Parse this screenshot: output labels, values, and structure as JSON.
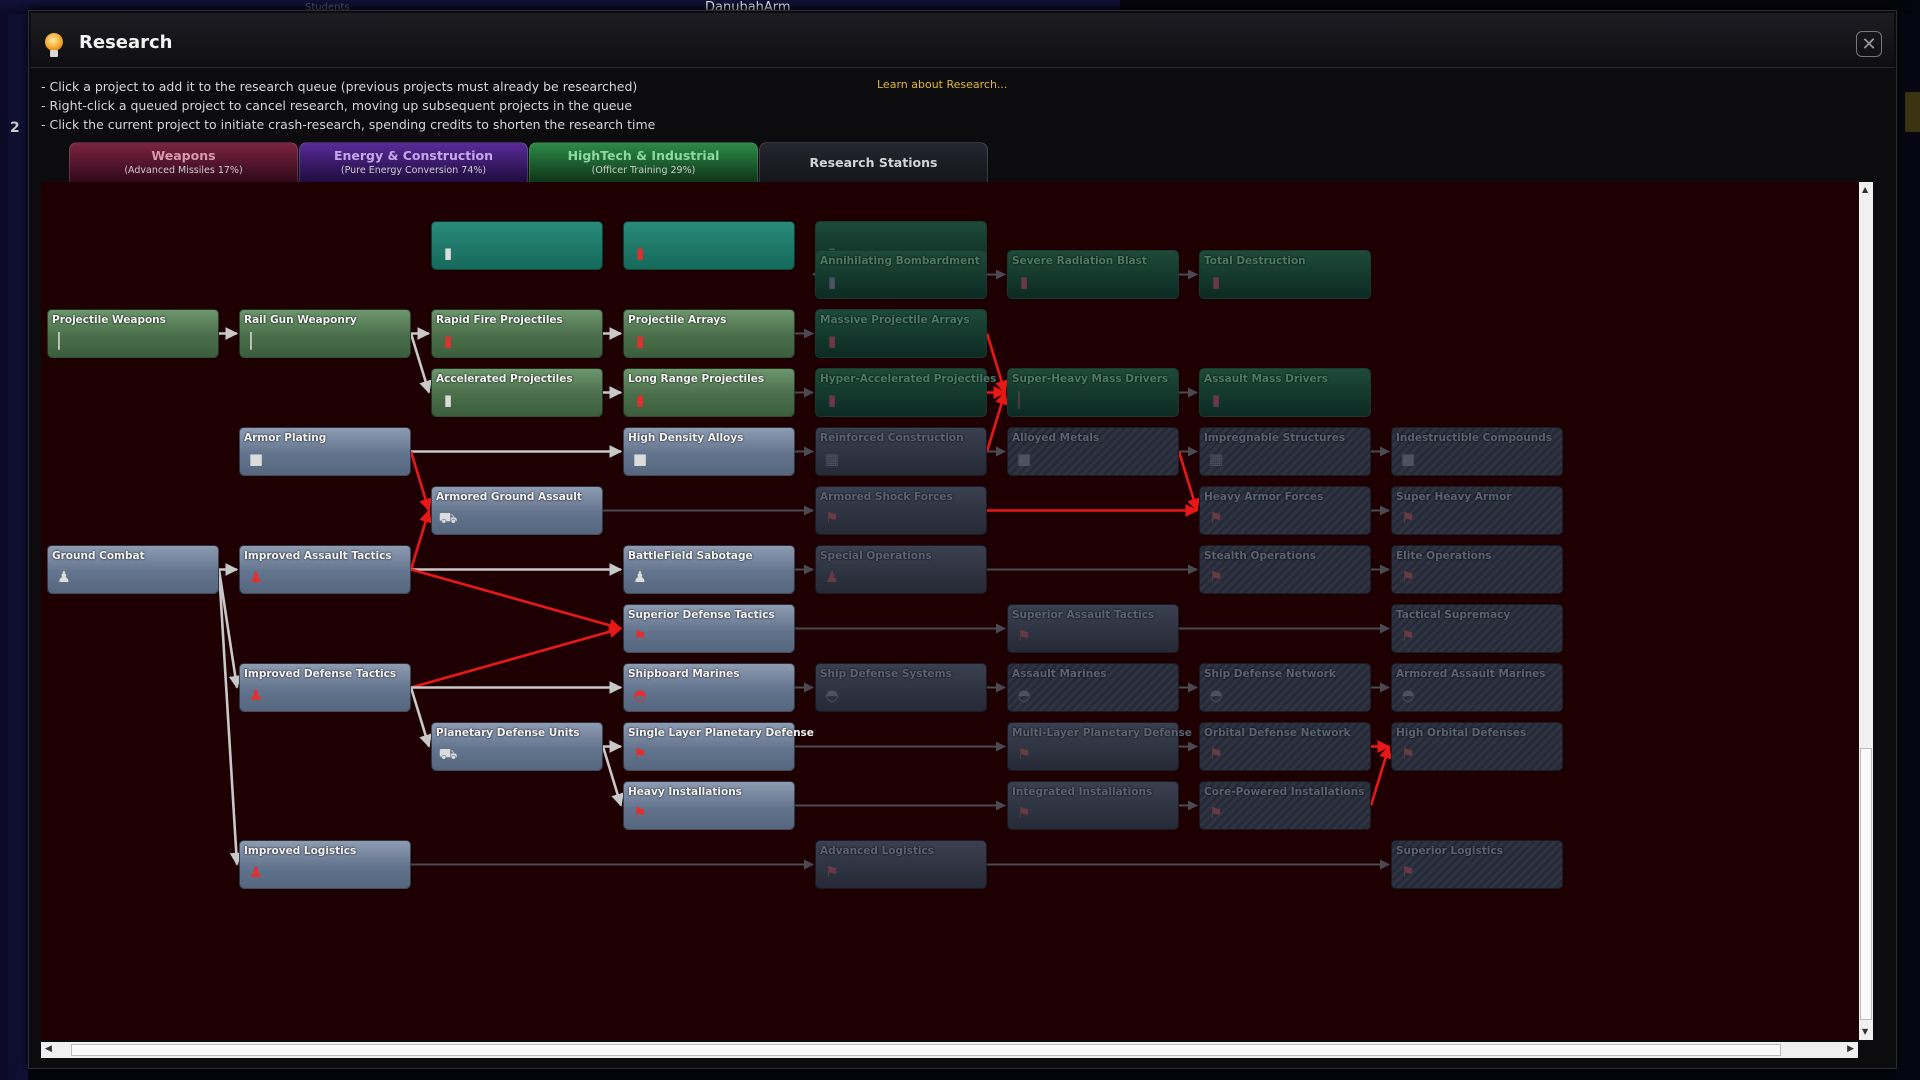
{
  "background": {
    "top_label": "DanubahArm",
    "top_label2": "Students",
    "left_number": "2"
  },
  "window": {
    "title": "Research",
    "title_icon": "light-bulb-icon",
    "close_glyph": "✕"
  },
  "instructions": [
    "- Click a project to add it to the research queue (previous projects must already be researched)",
    "- Right-click a queued project to cancel research, moving up subsequent projects in the queue",
    "- Click the current project to initiate crash-research, spending credits to shorten the research time"
  ],
  "learn_link": "Learn about Research...",
  "tabs": [
    {
      "id": "weapons",
      "label": "Weapons",
      "sub": "(Advanced Missiles 17%)",
      "color": "#7a2440"
    },
    {
      "id": "energy",
      "label": "Energy & Construction",
      "sub": "(Pure Energy Conversion 74%)",
      "color": "#5a2a98"
    },
    {
      "id": "hightech",
      "label": "HighTech & Industrial",
      "sub": "(Officer Training 29%)",
      "color": "#2c8a48"
    },
    {
      "id": "stations",
      "label": "Research Stations",
      "sub": "",
      "color": "#262630"
    }
  ],
  "scrollbars": {
    "left": "◀",
    "right": "▶",
    "up": "▲",
    "down": "▼"
  },
  "nodes": [
    {
      "id": "teal1",
      "label": "",
      "style": "teal",
      "icon": "shell-icon",
      "glyph": "▮",
      "tone": "silver",
      "col": 2,
      "row": -0.5
    },
    {
      "id": "teal2",
      "label": "",
      "style": "teal",
      "icon": "shell-icon",
      "glyph": "▮",
      "tone": "red",
      "col": 3,
      "row": -0.5
    },
    {
      "id": "teal3",
      "label": "",
      "style": "dgreen",
      "icon": "shell-icon",
      "glyph": "▮",
      "tone": "dimgray",
      "col": 4,
      "row": -0.5
    },
    {
      "id": "annihilating",
      "label": "Annihilating Bombardment",
      "style": "dgreen",
      "icon": "bomb-icon",
      "glyph": "▮",
      "tone": "dimgray",
      "col": 4,
      "row": 0
    },
    {
      "id": "severe",
      "label": "Severe Radiation Blast",
      "style": "dgreen",
      "icon": "radiation-icon",
      "glyph": "▮",
      "tone": "dim",
      "col": 5,
      "row": 0
    },
    {
      "id": "total",
      "label": "Total Destruction",
      "style": "dgreen",
      "icon": "bomb-icon",
      "glyph": "▮",
      "tone": "dim",
      "col": 6,
      "row": 0
    },
    {
      "id": "projweap",
      "label": "Projectile Weapons",
      "style": "green",
      "icon": "projectile-icon",
      "glyph": "▏",
      "tone": "silver",
      "col": 0,
      "row": 1
    },
    {
      "id": "railgun",
      "label": "Rail Gun Weaponry",
      "style": "green",
      "icon": "projectile-icon",
      "glyph": "▏",
      "tone": "silver",
      "col": 1,
      "row": 1
    },
    {
      "id": "rapidfire",
      "label": "Rapid Fire Projectiles",
      "style": "green",
      "icon": "shell-icon",
      "glyph": "▮",
      "tone": "red",
      "col": 2,
      "row": 1
    },
    {
      "id": "projarrays",
      "label": "Projectile Arrays",
      "style": "green",
      "icon": "shell-icon",
      "glyph": "▮",
      "tone": "red",
      "col": 3,
      "row": 1
    },
    {
      "id": "massive",
      "label": "Massive Projectile Arrays",
      "style": "dgreen",
      "icon": "shell-icon",
      "glyph": "▮",
      "tone": "dim",
      "col": 4,
      "row": 1
    },
    {
      "id": "accel",
      "label": "Accelerated Projectiles",
      "style": "green",
      "icon": "projectile-icon",
      "glyph": "▮",
      "tone": "silver",
      "col": 2,
      "row": 2
    },
    {
      "id": "longrange",
      "label": "Long Range Projectiles",
      "style": "green",
      "icon": "shell-icon",
      "glyph": "▮",
      "tone": "red",
      "col": 3,
      "row": 2
    },
    {
      "id": "hyperaccel",
      "label": "Hyper-Accelerated Projectiles",
      "style": "dgreen",
      "icon": "shell-icon",
      "glyph": "▮",
      "tone": "dim",
      "col": 4,
      "row": 2
    },
    {
      "id": "superheavy",
      "label": "Super-Heavy Mass Drivers",
      "style": "dgreen",
      "icon": "projectile-icon",
      "glyph": "▏",
      "tone": "dim",
      "col": 5,
      "row": 2
    },
    {
      "id": "assaultmass",
      "label": "Assault Mass Drivers",
      "style": "dgreen",
      "icon": "shell-icon",
      "glyph": "▮",
      "tone": "dim",
      "col": 6,
      "row": 2
    },
    {
      "id": "armor",
      "label": "Armor Plating",
      "style": "blue",
      "icon": "armor-plate-icon",
      "glyph": "■",
      "tone": "silver",
      "col": 1,
      "row": 3
    },
    {
      "id": "highdensity",
      "label": "High Density Alloys",
      "style": "blue",
      "icon": "armor-plate-icon",
      "glyph": "■",
      "tone": "silver",
      "col": 3,
      "row": 3
    },
    {
      "id": "reinforced",
      "label": "Reinforced Construction",
      "style": "dgray",
      "icon": "structure-icon",
      "glyph": "▦",
      "tone": "dimgray",
      "col": 4,
      "row": 3
    },
    {
      "id": "alloyed",
      "label": "Alloyed Metals",
      "style": "dgray hatched",
      "icon": "armor-plate-icon",
      "glyph": "■",
      "tone": "dimgray",
      "col": 5,
      "row": 3
    },
    {
      "id": "impregnable",
      "label": "Impregnable Structures",
      "style": "dgray hatched",
      "icon": "structure-icon",
      "glyph": "▦",
      "tone": "dimgray",
      "col": 6,
      "row": 3
    },
    {
      "id": "indestructible",
      "label": "Indestructible Compounds",
      "style": "dgray hatched",
      "icon": "armor-plate-icon",
      "glyph": "■",
      "tone": "dimgray",
      "col": 7,
      "row": 3
    },
    {
      "id": "armoredground",
      "label": "Armored Ground Assault",
      "style": "blue",
      "icon": "tank-icon",
      "glyph": "⛟",
      "tone": "silver",
      "col": 2,
      "row": 4
    },
    {
      "id": "armoredshock",
      "label": "Armored Shock Forces",
      "style": "dgray",
      "icon": "flag-icon",
      "glyph": "⚑",
      "tone": "dim",
      "col": 4,
      "row": 4
    },
    {
      "id": "heavyarmor",
      "label": "Heavy Armor Forces",
      "style": "dgray hatched",
      "icon": "flag-icon",
      "glyph": "⚑",
      "tone": "dim",
      "col": 6,
      "row": 4
    },
    {
      "id": "superheavyarmor",
      "label": "Super Heavy Armor",
      "style": "dgray hatched",
      "icon": "flag-icon",
      "glyph": "⚑",
      "tone": "dim",
      "col": 7,
      "row": 4
    },
    {
      "id": "groundcombat",
      "label": "Ground Combat",
      "style": "blue",
      "icon": "soldiers-icon",
      "glyph": "♟",
      "tone": "silver",
      "col": 0,
      "row": 5
    },
    {
      "id": "assaulttactics",
      "label": "Improved Assault Tactics",
      "style": "blue",
      "icon": "soldiers-icon",
      "glyph": "♟",
      "tone": "red",
      "col": 1,
      "row": 5
    },
    {
      "id": "sabotage",
      "label": "BattleField Sabotage",
      "style": "blue",
      "icon": "soldiers-icon",
      "glyph": "♟",
      "tone": "silver",
      "col": 3,
      "row": 5
    },
    {
      "id": "specialops",
      "label": "Special Operations",
      "style": "dgray",
      "icon": "soldiers-icon",
      "glyph": "♟",
      "tone": "dim",
      "col": 4,
      "row": 5
    },
    {
      "id": "stealthops",
      "label": "Stealth Operations",
      "style": "dgray hatched",
      "icon": "flag-icon",
      "glyph": "⚑",
      "tone": "dim",
      "col": 6,
      "row": 5
    },
    {
      "id": "eliteops",
      "label": "Elite Operations",
      "style": "dgray hatched",
      "icon": "flag-icon",
      "glyph": "⚑",
      "tone": "dim",
      "col": 7,
      "row": 5
    },
    {
      "id": "superiordef",
      "label": "Superior Defense Tactics",
      "style": "blue",
      "icon": "flag-icon",
      "glyph": "⚑",
      "tone": "red",
      "col": 3,
      "row": 6
    },
    {
      "id": "superiorassault",
      "label": "Superior Assault Tactics",
      "style": "dgray",
      "icon": "flag-icon",
      "glyph": "⚑",
      "tone": "dim",
      "col": 5,
      "row": 6
    },
    {
      "id": "tactical",
      "label": "Tactical Supremacy",
      "style": "dgray hatched",
      "icon": "flag-icon",
      "glyph": "⚑",
      "tone": "dim",
      "col": 7,
      "row": 6
    },
    {
      "id": "deftactics",
      "label": "Improved Defense Tactics",
      "style": "blue",
      "icon": "soldiers-icon",
      "glyph": "♟",
      "tone": "red",
      "col": 1,
      "row": 7
    },
    {
      "id": "marines",
      "label": "Shipboard Marines",
      "style": "blue",
      "icon": "helmet-icon",
      "glyph": "◓",
      "tone": "red",
      "col": 3,
      "row": 7
    },
    {
      "id": "shipdefsys",
      "label": "Ship Defense Systems",
      "style": "dgray",
      "icon": "helmet-icon",
      "glyph": "◓",
      "tone": "dimgray",
      "col": 4,
      "row": 7
    },
    {
      "id": "assaultmarines",
      "label": "Assault Marines",
      "style": "dgray hatched",
      "icon": "helmet-icon",
      "glyph": "◓",
      "tone": "dimgray",
      "col": 5,
      "row": 7
    },
    {
      "id": "shipdefnet",
      "label": "Ship Defense Network",
      "style": "dgray hatched",
      "icon": "helmet-icon",
      "glyph": "◓",
      "tone": "dimgray",
      "col": 6,
      "row": 7
    },
    {
      "id": "armoredassaultmarines",
      "label": "Armored Assault Marines",
      "style": "dgray hatched",
      "icon": "helmet-icon",
      "glyph": "◓",
      "tone": "dimgray",
      "col": 7,
      "row": 7
    },
    {
      "id": "planetarydef",
      "label": "Planetary Defense Units",
      "style": "blue",
      "icon": "tank-icon",
      "glyph": "⛟",
      "tone": "silver",
      "col": 2,
      "row": 8
    },
    {
      "id": "singlelayer",
      "label": "Single Layer Planetary Defense",
      "style": "blue",
      "icon": "flag-icon",
      "glyph": "⚑",
      "tone": "red",
      "col": 3,
      "row": 8
    },
    {
      "id": "multilayer",
      "label": "Multi-Layer Planetary Defense",
      "style": "dgray",
      "icon": "flag-icon",
      "glyph": "⚑",
      "tone": "dim",
      "col": 5,
      "row": 8
    },
    {
      "id": "orbitaldefnet",
      "label": "Orbital Defense Network",
      "style": "dgray hatched",
      "icon": "flag-icon",
      "glyph": "⚑",
      "tone": "dim",
      "col": 6,
      "row": 8
    },
    {
      "id": "highorbital",
      "label": "High Orbital Defenses",
      "style": "dgray hatched",
      "icon": "flag-icon",
      "glyph": "⚑",
      "tone": "dim",
      "col": 7,
      "row": 8
    },
    {
      "id": "heavyinst",
      "label": "Heavy Installations",
      "style": "blue",
      "icon": "flag-icon",
      "glyph": "⚑",
      "tone": "red",
      "col": 3,
      "row": 9
    },
    {
      "id": "integrated",
      "label": "Integrated Installations",
      "style": "dgray",
      "icon": "flag-icon",
      "glyph": "⚑",
      "tone": "dim",
      "col": 5,
      "row": 9
    },
    {
      "id": "corepowered",
      "label": "Core-Powered Installations",
      "style": "dgray hatched",
      "icon": "flag-icon",
      "glyph": "⚑",
      "tone": "dim",
      "col": 6,
      "row": 9
    },
    {
      "id": "logistics",
      "label": "Improved Logistics",
      "style": "blue",
      "icon": "soldiers-icon",
      "glyph": "♟",
      "tone": "red",
      "col": 1,
      "row": 10
    },
    {
      "id": "advlogistics",
      "label": "Advanced Logistics",
      "style": "dgray",
      "icon": "flag-icon",
      "glyph": "⚑",
      "tone": "dim",
      "col": 4,
      "row": 10
    },
    {
      "id": "superiorlogistics",
      "label": "Superior Logistics",
      "style": "dgray hatched",
      "icon": "flag-icon",
      "glyph": "⚑",
      "tone": "dim",
      "col": 7,
      "row": 10
    }
  ],
  "links": [
    [
      "teal3",
      "annihilating",
      "gray"
    ],
    [
      "annihilating",
      "severe",
      "gray"
    ],
    [
      "severe",
      "total",
      "gray"
    ],
    [
      "projweap",
      "railgun",
      "white"
    ],
    [
      "railgun",
      "rapidfire",
      "white"
    ],
    [
      "railgun",
      "accel",
      "white"
    ],
    [
      "rapidfire",
      "projarrays",
      "white"
    ],
    [
      "accel",
      "longrange",
      "white"
    ],
    [
      "projarrays",
      "massive",
      "gray"
    ],
    [
      "longrange",
      "hyperaccel",
      "gray"
    ],
    [
      "massive",
      "superheavy",
      "red"
    ],
    [
      "hyperaccel",
      "superheavy",
      "red"
    ],
    [
      "superheavy",
      "assaultmass",
      "gray"
    ],
    [
      "armor",
      "highdensity",
      "white"
    ],
    [
      "armor",
      "armoredground",
      "red"
    ],
    [
      "highdensity",
      "reinforced",
      "gray"
    ],
    [
      "reinforced",
      "superheavy",
      "red"
    ],
    [
      "reinforced",
      "alloyed",
      "gray"
    ],
    [
      "alloyed",
      "impregnable",
      "gray"
    ],
    [
      "alloyed",
      "heavyarmor",
      "red"
    ],
    [
      "impregnable",
      "indestructible",
      "gray"
    ],
    [
      "armoredground",
      "armoredshock",
      "gray"
    ],
    [
      "armoredshock",
      "heavyarmor",
      "red"
    ],
    [
      "heavyarmor",
      "superheavyarmor",
      "gray"
    ],
    [
      "groundcombat",
      "assaulttactics",
      "white"
    ],
    [
      "groundcombat",
      "deftactics",
      "white"
    ],
    [
      "groundcombat",
      "logistics",
      "white"
    ],
    [
      "assaulttactics",
      "armoredground",
      "red"
    ],
    [
      "assaulttactics",
      "sabotage",
      "white"
    ],
    [
      "assaulttactics",
      "superiordef",
      "red"
    ],
    [
      "sabotage",
      "specialops",
      "gray"
    ],
    [
      "specialops",
      "stealthops",
      "gray"
    ],
    [
      "stealthops",
      "eliteops",
      "gray"
    ],
    [
      "superiordef",
      "superiorassault",
      "gray"
    ],
    [
      "superiorassault",
      "tactical",
      "gray"
    ],
    [
      "deftactics",
      "superiordef",
      "red"
    ],
    [
      "deftactics",
      "marines",
      "white"
    ],
    [
      "deftactics",
      "planetarydef",
      "white"
    ],
    [
      "marines",
      "shipdefsys",
      "gray"
    ],
    [
      "shipdefsys",
      "assaultmarines",
      "gray"
    ],
    [
      "assaultmarines",
      "shipdefnet",
      "gray"
    ],
    [
      "shipdefnet",
      "armoredassaultmarines",
      "gray"
    ],
    [
      "planetarydef",
      "singlelayer",
      "white"
    ],
    [
      "planetarydef",
      "heavyinst",
      "white"
    ],
    [
      "singlelayer",
      "multilayer",
      "gray"
    ],
    [
      "multilayer",
      "orbitaldefnet",
      "gray"
    ],
    [
      "orbitaldefnet",
      "highorbital",
      "red"
    ],
    [
      "heavyinst",
      "integrated",
      "gray"
    ],
    [
      "integrated",
      "corepowered",
      "gray"
    ],
    [
      "corepowered",
      "highorbital",
      "red"
    ],
    [
      "logistics",
      "advlogistics",
      "gray"
    ],
    [
      "advlogistics",
      "superiorlogistics",
      "gray"
    ]
  ]
}
